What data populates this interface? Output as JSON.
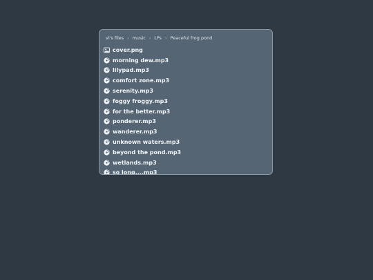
{
  "breadcrumb": [
    "vl's files",
    "music",
    "LPs",
    "Peaceful frog pond"
  ],
  "breadcrumb_separator": "›",
  "files": [
    {
      "name": "cover.png",
      "icon": "image-icon"
    },
    {
      "name": "morning dew.mp3",
      "icon": "music-disc-icon"
    },
    {
      "name": "lilypad.mp3",
      "icon": "music-disc-icon"
    },
    {
      "name": "comfort zone.mp3",
      "icon": "music-disc-icon"
    },
    {
      "name": "serenity.mp3",
      "icon": "music-disc-icon"
    },
    {
      "name": "foggy froggy.mp3",
      "icon": "music-disc-icon"
    },
    {
      "name": "for the better.mp3",
      "icon": "music-disc-icon"
    },
    {
      "name": "ponderer.mp3",
      "icon": "music-disc-icon"
    },
    {
      "name": "wanderer.mp3",
      "icon": "music-disc-icon"
    },
    {
      "name": "unknown waters.mp3",
      "icon": "music-disc-icon"
    },
    {
      "name": "beyond the pond.mp3",
      "icon": "music-disc-icon"
    },
    {
      "name": "wetlands.mp3",
      "icon": "music-disc-icon"
    },
    {
      "name": "so long....mp3",
      "icon": "music-disc-icon"
    }
  ],
  "colors": {
    "background": "#2e3944",
    "panel": "#566573",
    "panel_border": "#8a98a6",
    "text": "#f0f4f7"
  }
}
